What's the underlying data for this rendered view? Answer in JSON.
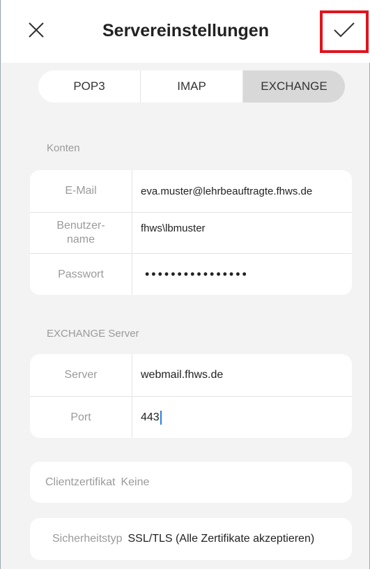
{
  "header": {
    "title": "Servereinstellungen",
    "close_icon": "close-icon",
    "confirm_icon": "checkmark-icon",
    "highlight_color": "#e0141e"
  },
  "protocol_tabs": [
    {
      "label": "POP3",
      "selected": false
    },
    {
      "label": "IMAP",
      "selected": false
    },
    {
      "label": "EXCHANGE",
      "selected": true
    }
  ],
  "accounts": {
    "section_label": "Konten",
    "email": {
      "label": "E-Mail",
      "value": "eva.muster@lehrbeauftragte.fhws.de"
    },
    "username": {
      "label": "Benutzer-\nname",
      "value": "fhws\\lbmuster"
    },
    "password": {
      "label": "Passwort",
      "value": "••••••••••••••••"
    }
  },
  "exchange_server": {
    "section_label": "EXCHANGE Server",
    "server": {
      "label": "Server",
      "value": "webmail.fhws.de"
    },
    "port": {
      "label": "Port",
      "value": "443"
    }
  },
  "client_certificate": {
    "label": "Clientzertifikat",
    "value": "Keine"
  },
  "security_type": {
    "label": "Sicherheitstyp",
    "value": "SSL/TLS (Alle Zertifikate akzeptieren)"
  }
}
